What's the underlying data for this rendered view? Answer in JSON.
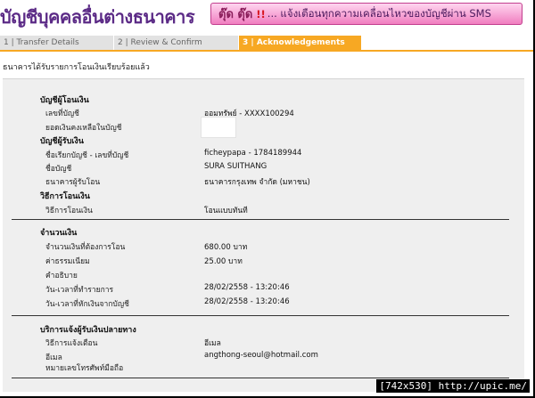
{
  "header": {
    "title": "บัญชีบุคคลอื่นต่างธนาคาร",
    "banner": {
      "brand": "ตุ๊ด ตุ๊ด",
      "exclaim": "!!",
      "text": "... แจ้งเตือนทุกความเคลื่อนไหวของบัญชีผ่าน SMS"
    }
  },
  "steps": [
    {
      "label": "1 | Transfer Details",
      "active": false
    },
    {
      "label": "2 | Review & Confirm",
      "active": false
    },
    {
      "label": "3 | Acknowledgements",
      "active": true
    }
  ],
  "success_message": "ธนาคารได้รับรายการโอนเงินเรียบร้อยแล้ว",
  "from_account": {
    "title": "บัญชีผู้โอนเงิน",
    "account_no_label": "เลขที่บัญชี",
    "account_no_value": "ออมทรัพย์ - XXXX100294",
    "balance_label": "ยอดเงินคงเหลือในบัญชี"
  },
  "to_account": {
    "title": "บัญชีผู้รับเงิน",
    "nickname_label": "ชื่อเรียกบัญชี - เลขที่บัญชี",
    "nickname_value": "ficheypapa - 1784189944",
    "name_label": "ชื่อบัญชี",
    "name_value": "SURA SUITHANG",
    "bank_label": "ธนาคารผู้รับโอน",
    "bank_value": "ธนาคารกรุงเทพ จำกัด (มหาชน)"
  },
  "method": {
    "title": "วิธีการโอนเงิน",
    "label": "วิธีการโอนเงิน",
    "value": "โอนแบบทันที"
  },
  "amount": {
    "title": "จำนวนเงิน",
    "amount_label": "จำนวนเงินที่ต้องการโอน",
    "amount_value": "680.00 บาท",
    "fee_label": "ค่าธรรมเนียม",
    "fee_value": "25.00  บาท",
    "desc_label": "คำอธิบาย",
    "txn_time_label": "วัน-เวลาที่ทำรายการ",
    "txn_time_value": "28/02/2558 - 13:20:46",
    "debit_time_label": "วัน-เวลาที่หักเงินจากบัญชี",
    "debit_time_value": "28/02/2558 - 13:20:46"
  },
  "notify": {
    "title": "บริการแจ้งผู้รับเงินปลายทาง",
    "method_label": "วิธีการแจ้งเตือน",
    "method_value": "อีเมล",
    "email_label": "อีเมล",
    "email_value": "angthong-seoul@hotmail.com",
    "phone_label": "หมายเลขโทรศัพท์มือถือ"
  },
  "watermark": "[742x530] http://upic.me/"
}
